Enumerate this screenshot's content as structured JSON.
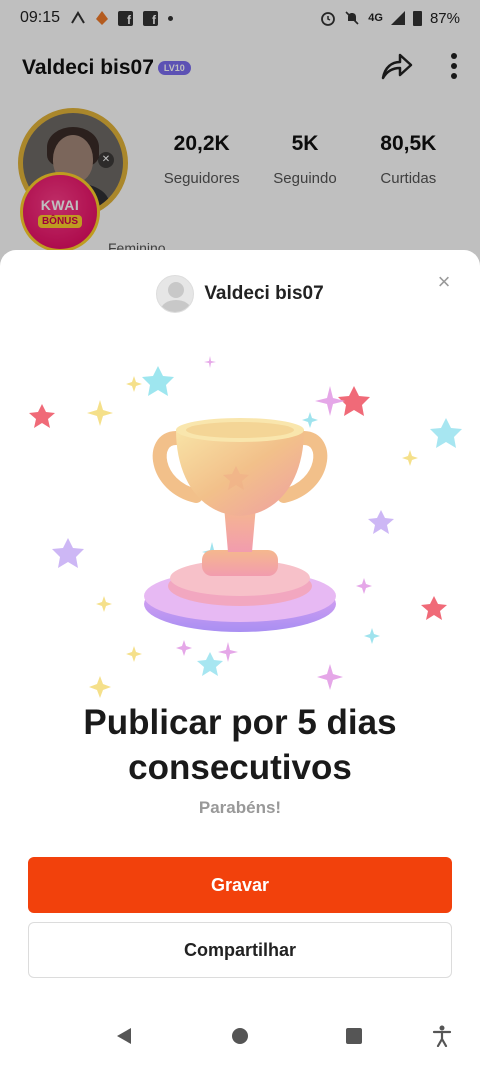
{
  "status_bar": {
    "time": "09:15",
    "network": "4G",
    "battery": "87%"
  },
  "profile": {
    "username": "Valdeci bis07",
    "level_badge": "LV10",
    "kwai_bonus": {
      "line1": "KWAI",
      "line2": "BÔNUS"
    },
    "stats": [
      {
        "value": "20,2K",
        "label": "Seguidores"
      },
      {
        "value": "5K",
        "label": "Seguindo"
      },
      {
        "value": "80,5K",
        "label": "Curtidas"
      }
    ],
    "sub_info": {
      "left": "Feminino"
    }
  },
  "sheet": {
    "username": "Valdeci bis07",
    "title": "Publicar por 5 dias consecutivos",
    "subtitle": "Parabéns!",
    "primary_button": "Gravar",
    "secondary_button": "Compartilhar",
    "accent_color": "#f2410c"
  },
  "icons": {
    "close": "×"
  }
}
